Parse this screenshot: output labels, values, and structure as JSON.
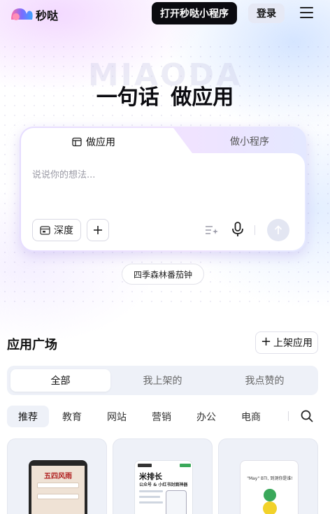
{
  "header": {
    "brand": "秒哒",
    "open_mini_program": "打开秒哒小程序",
    "login": "登录",
    "menu_icon": "hamburger-icon"
  },
  "hero": {
    "watermark": "MIAODA",
    "headline": "一句话  做应用"
  },
  "composer": {
    "tabs": [
      {
        "label": "做应用",
        "icon": "app-window-icon",
        "active": true
      },
      {
        "label": "做小程序",
        "active": false
      }
    ],
    "placeholder": "说说你的想法...",
    "deep_label": "深度",
    "add_icon": "plus-icon",
    "magic_icon": "prompt-enhance-icon",
    "mic_icon": "microphone-icon",
    "send_icon": "arrow-up-icon"
  },
  "suggestion": "四季森林番茄钟",
  "plaza": {
    "title": "应用广场",
    "publish_label": "上架应用",
    "segments": [
      "全部",
      "我上架的",
      "我点赞的"
    ],
    "active_segment": "全部",
    "categories": [
      "推荐",
      "教育",
      "网站",
      "营销",
      "办公",
      "电商"
    ],
    "active_category": "推荐",
    "search_icon": "search-icon",
    "cards": [
      {
        "thumb_title": "五四风雨"
      },
      {
        "thumb_title": "米排长",
        "thumb_subtitle": "公众号 & 小红书封面神器"
      },
      {
        "thumb_title": "\"May\" BTI, 到测你是谁!"
      }
    ]
  },
  "colors": {
    "primary_dark": "#0b0b10",
    "composer_gradient_start": "#e6ddff",
    "composer_gradient_end": "#e4e8ff",
    "segment_bg": "#eef1f8"
  }
}
